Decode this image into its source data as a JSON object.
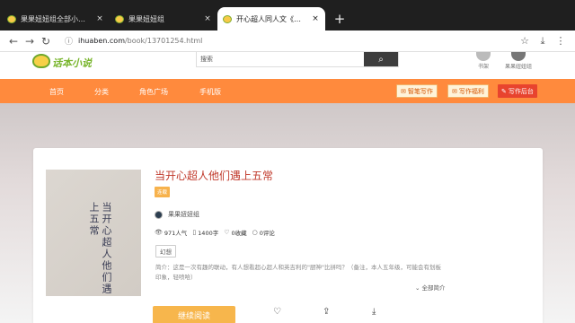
{
  "browser": {
    "tabs": [
      {
        "title": "果果妞妞组全部小说_果果妞妞组",
        "active": false
      },
      {
        "title": "果果妞妞组",
        "active": false
      },
      {
        "title": "开心超人同人文《当开心超人他们遇上五常》",
        "active": true
      }
    ],
    "close_glyph": "×",
    "new_tab_glyph": "+",
    "url_host": "ihuaben.com",
    "url_path": "/book/13701254.html"
  },
  "site": {
    "logo_text": "话本小说",
    "search_placeholder": "搜索",
    "user_items": [
      {
        "label": "书架"
      },
      {
        "label": "果果妞妞组"
      }
    ],
    "nav": [
      "首页",
      "分类",
      "角色广场",
      "手机版"
    ],
    "nav_buttons": {
      "smart_write": "智笔写作",
      "welfare": "写作福利",
      "backend": "写作后台"
    }
  },
  "book": {
    "title": "当开心超人他们遇上五常",
    "cover_text": "当开心超人他们遇上五常",
    "status": "连载",
    "author": "果果妞妞组",
    "popularity": "971人气",
    "word_count": "1400字",
    "favorites": "0收藏",
    "comments": "0评论",
    "tag": "幻想",
    "synopsis": "简介：这是一次有趣的联动，有人想看超心超人和英吉利的\"厨神\"比拼吗？（备注，本人五年级，可能会有划板印象，轻喷哈）",
    "expand_label": "全部简介",
    "read_button": "继续阅读"
  },
  "colors": {
    "nav_orange": "#ff8a3d",
    "title_red": "#c0392b",
    "accent_yellow": "#f7b64c"
  }
}
